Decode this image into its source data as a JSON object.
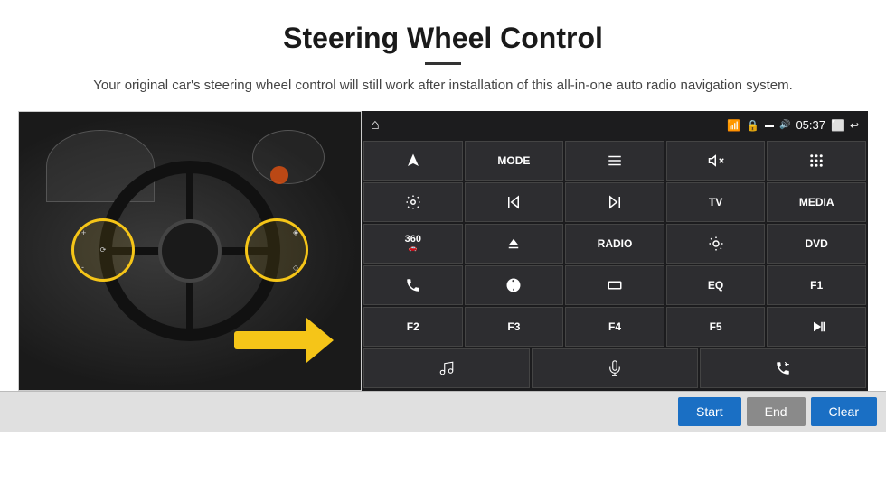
{
  "header": {
    "title": "Steering Wheel Control",
    "subtitle": "Your original car's steering wheel control will still work after installation of this all-in-one auto radio navigation system.",
    "divider": true
  },
  "panel": {
    "status": {
      "time": "05:37"
    },
    "grid_rows": [
      [
        {
          "type": "icon",
          "icon": "navigate-icon",
          "label": ""
        },
        {
          "type": "text",
          "label": "MODE"
        },
        {
          "type": "icon",
          "icon": "list-icon",
          "label": ""
        },
        {
          "type": "icon",
          "icon": "mute-icon",
          "label": ""
        },
        {
          "type": "icon",
          "icon": "apps-icon",
          "label": ""
        }
      ],
      [
        {
          "type": "icon",
          "icon": "settings-icon",
          "label": ""
        },
        {
          "type": "icon",
          "icon": "prev-icon",
          "label": ""
        },
        {
          "type": "icon",
          "icon": "next-icon",
          "label": ""
        },
        {
          "type": "text",
          "label": "TV"
        },
        {
          "type": "text",
          "label": "MEDIA"
        }
      ],
      [
        {
          "type": "icon",
          "icon": "360-icon",
          "label": ""
        },
        {
          "type": "icon",
          "icon": "eject-icon",
          "label": ""
        },
        {
          "type": "text",
          "label": "RADIO"
        },
        {
          "type": "icon",
          "icon": "brightness-icon",
          "label": ""
        },
        {
          "type": "text",
          "label": "DVD"
        }
      ],
      [
        {
          "type": "icon",
          "icon": "phone-icon",
          "label": ""
        },
        {
          "type": "icon",
          "icon": "swirl-icon",
          "label": ""
        },
        {
          "type": "icon",
          "icon": "rectangle-icon",
          "label": ""
        },
        {
          "type": "text",
          "label": "EQ"
        },
        {
          "type": "text",
          "label": "F1"
        }
      ],
      [
        {
          "type": "text",
          "label": "F2"
        },
        {
          "type": "text",
          "label": "F3"
        },
        {
          "type": "text",
          "label": "F4"
        },
        {
          "type": "text",
          "label": "F5"
        },
        {
          "type": "icon",
          "icon": "play-pause-icon",
          "label": ""
        }
      ]
    ],
    "last_row": [
      {
        "type": "icon",
        "icon": "music-icon",
        "label": ""
      },
      {
        "type": "icon",
        "icon": "mic-icon",
        "label": ""
      },
      {
        "type": "icon",
        "icon": "phone-answer-icon",
        "label": ""
      }
    ]
  },
  "bottom_bar": {
    "start_label": "Start",
    "end_label": "End",
    "clear_label": "Clear"
  },
  "colors": {
    "accent_blue": "#1a6fc4",
    "panel_bg": "#1c1c1e",
    "btn_bg": "#2d2d30",
    "disabled_gray": "#8a8a8a"
  }
}
